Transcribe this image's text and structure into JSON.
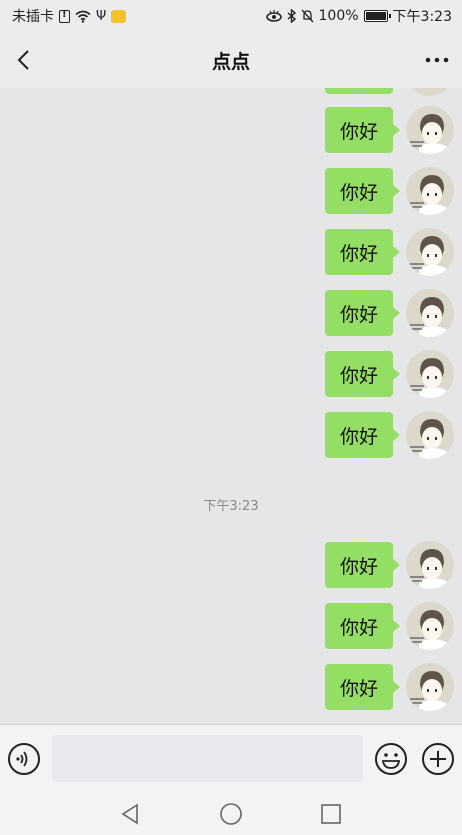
{
  "status_bar": {
    "carrier": "未插卡",
    "battery": "100%",
    "time": "下午3:23"
  },
  "header": {
    "title": "点点"
  },
  "messages": [
    {
      "text": "你好"
    },
    {
      "text": "你好"
    },
    {
      "text": "你好"
    },
    {
      "text": "你好"
    },
    {
      "text": "你好"
    },
    {
      "text": "你好"
    },
    {
      "text": "你好"
    },
    {
      "text": "你好"
    },
    {
      "text": "你好"
    }
  ],
  "timestamp": "下午3:23",
  "input": {
    "value": "",
    "placeholder": ""
  },
  "icons": {
    "back": "back-arrow-icon",
    "more": "more-dots-icon",
    "voice": "voice-icon",
    "emoji": "emoji-icon",
    "plus": "plus-icon",
    "nav_back": "nav-back-icon",
    "nav_home": "nav-home-icon",
    "nav_recent": "nav-recent-icon"
  },
  "colors": {
    "bubble": "#95de66",
    "background": "#e6e6e8"
  }
}
